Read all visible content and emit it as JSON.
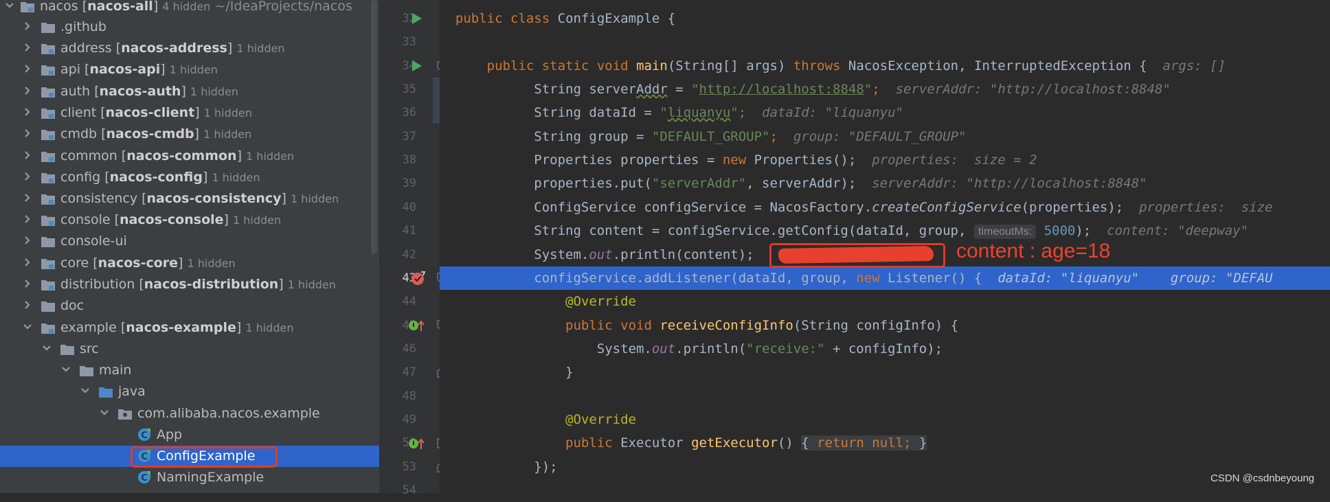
{
  "project_tree": {
    "root": {
      "name": "nacos",
      "module": "nacos-all",
      "hint": "4 hidden",
      "path": "~/IdeaProjects/nacos"
    },
    "items": [
      {
        "name": ".github",
        "module": "",
        "hint": ""
      },
      {
        "name": "address",
        "module": "nacos-address",
        "hint": "1 hidden"
      },
      {
        "name": "api",
        "module": "nacos-api",
        "hint": "1 hidden"
      },
      {
        "name": "auth",
        "module": "nacos-auth",
        "hint": "1 hidden"
      },
      {
        "name": "client",
        "module": "nacos-client",
        "hint": "1 hidden"
      },
      {
        "name": "cmdb",
        "module": "nacos-cmdb",
        "hint": "1 hidden"
      },
      {
        "name": "common",
        "module": "nacos-common",
        "hint": "1 hidden"
      },
      {
        "name": "config",
        "module": "nacos-config",
        "hint": "1 hidden"
      },
      {
        "name": "consistency",
        "module": "nacos-consistency",
        "hint": "1 hidden"
      },
      {
        "name": "console",
        "module": "nacos-console",
        "hint": "1 hidden"
      },
      {
        "name": "console-ui",
        "module": "",
        "hint": ""
      },
      {
        "name": "core",
        "module": "nacos-core",
        "hint": "1 hidden"
      },
      {
        "name": "distribution",
        "module": "nacos-distribution",
        "hint": "1 hidden"
      },
      {
        "name": "doc",
        "module": "",
        "hint": ""
      },
      {
        "name": "example",
        "module": "nacos-example",
        "hint": "1 hidden"
      },
      {
        "name": "src"
      },
      {
        "name": "main"
      },
      {
        "name": "java"
      },
      {
        "name": "com.alibaba.nacos.example"
      },
      {
        "name": "App"
      },
      {
        "name": "ConfigExample"
      },
      {
        "name": "NamingExample"
      }
    ]
  },
  "editor": {
    "line_numbers": [
      "32",
      "33",
      "34",
      "35",
      "36",
      "37",
      "38",
      "39",
      "40",
      "41",
      "42",
      "43",
      "44",
      "45",
      "46",
      "47",
      "48",
      "49",
      "50",
      "53",
      "54"
    ],
    "t": {
      "public": "public",
      "class": "class",
      "ConfigExample": "ConfigExample",
      "brace_open": " {",
      "static": "static",
      "void": "void",
      "main": "main",
      "String_args": "(String[] args) ",
      "throws": "throws",
      "exceptions": " NacosException, InterruptedException {",
      "hint_args": "args: []",
      "String_serverAddr_pre": "String server",
      "Addr": "Addr",
      "eq": " = ",
      "url_q1": "\"",
      "url": "http://localhost:8848",
      "url_q2": "\"",
      "semi": ";",
      "hint_serverAddr": "serverAddr: \"http://localhost:8848\"",
      "String_dataId": "String dataId = ",
      "liq_q1": "\"",
      "liquanyu": "liquanyu",
      "liq_q2": "\";",
      "hint_dataId": "dataId: \"liquanyu\"",
      "String_group": "String group = ",
      "default_group": "\"DEFAULT_GROUP\"",
      "hint_group": "group: \"DEFAULT_GROUP\"",
      "props_decl": "Properties properties = ",
      "new": "new",
      "props_ctor": " Properties();",
      "hint_props": "properties:  size = 2",
      "props_put": "properties.put(",
      "serverAddr_str": "\"serverAddr\"",
      "props_put_tail": ", serverAddr);",
      "hint_serverAddr2": "serverAddr: \"http://localhost:8848\"",
      "cs_decl": "ConfigService configService = NacosFactory.",
      "createConfigService": "createConfigService",
      "cs_tail": "(properties);",
      "hint_props2": "properties:  size",
      "content_decl": "String content = configService.getConfig(dataId, group, ",
      "timeoutMs": "timeoutMs:",
      "timeout_val": "5000",
      "content_tail": ");",
      "hint_content": "content: \"deepway\"",
      "sys": "System.",
      "out": "out",
      "println_content": ".println(content);",
      "add_listener": "configService.addListener(dataId, group, ",
      "listener_tail": " Listener() {",
      "hint_listener": "dataId: \"liquanyu\"    group: \"DEFAU",
      "override": "@Override",
      "receive_name": "receiveConfigInfo",
      "receive_args": "(String configInfo) {",
      "println_receive_pre": ".println(",
      "receive_str": "\"receive:\"",
      "println_receive_tail": " + configInfo);",
      "close_brace": "}",
      "executor_type": " Executor ",
      "getExecutor": "getExecutor",
      "parens": "()",
      "fold_open": "{",
      "return": "return",
      "null": "null;",
      "fold_close": "}",
      "close_listener": "});"
    }
  },
  "annotation": {
    "text": "content : age=18"
  },
  "watermark": "CSDN @csdnbeyoung",
  "colors": {
    "selection": "#2f65ca",
    "annotation_red": "#e03a2a",
    "keyword": "#cc7832",
    "string": "#6a8759"
  }
}
